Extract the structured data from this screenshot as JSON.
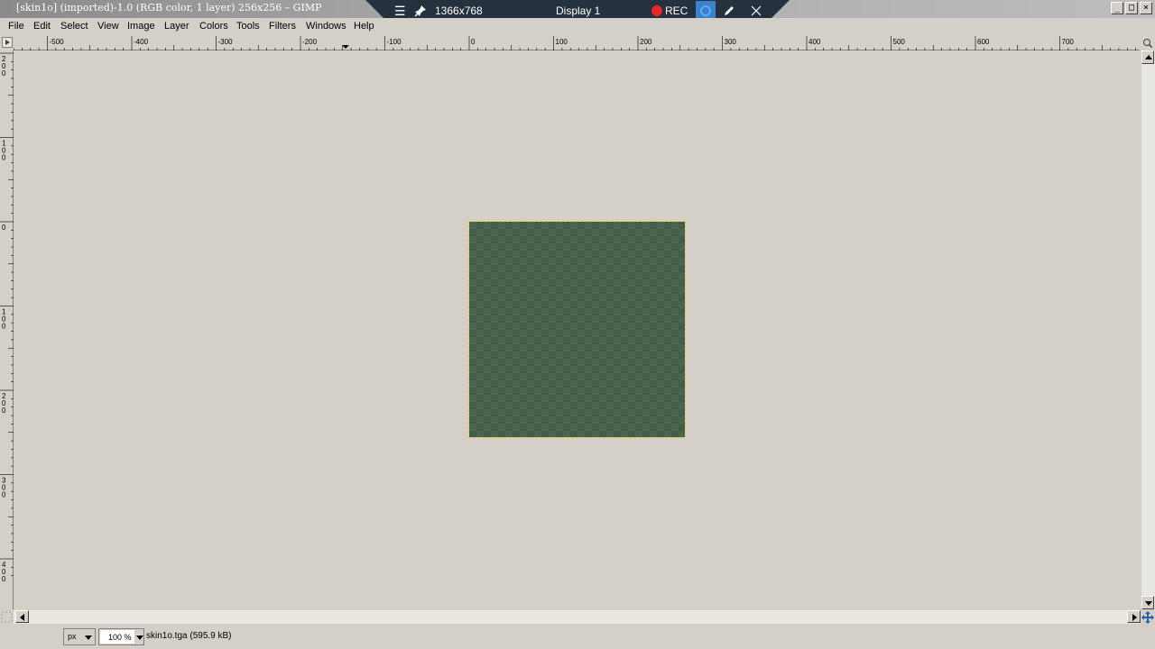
{
  "window": {
    "title": "[skin1o] (imported)-1.0 (RGB color, 1 layer) 256x256 – GIMP",
    "controls": [
      "minimize",
      "maximize",
      "close"
    ]
  },
  "recorder": {
    "resolution": "1366x768",
    "display": "Display 1",
    "rec_label": "REC",
    "icons": [
      "menu-icon",
      "pin-icon",
      "record-icon",
      "camera-icon",
      "pencil-icon",
      "close-icon"
    ]
  },
  "menubar": {
    "items": [
      "File",
      "Edit",
      "Select",
      "View",
      "Image",
      "Layer",
      "Colors",
      "Tools",
      "Filters",
      "Windows",
      "Help"
    ]
  },
  "rulers": {
    "horizontal_labels": [
      "-500",
      "-400",
      "-300",
      "-200",
      "-100",
      "0",
      "100",
      "200",
      "300",
      "400",
      "500",
      "600",
      "700"
    ],
    "vertical_labels": [
      "200",
      "100",
      "0",
      "100",
      "200",
      "300",
      "400"
    ]
  },
  "canvas": {
    "image_color": "#4a6651",
    "selection_color": "#e5d12f"
  },
  "statusbar": {
    "unit": "px",
    "zoom": "100 %",
    "message": "skin1o.tga (595.9 kB)"
  }
}
